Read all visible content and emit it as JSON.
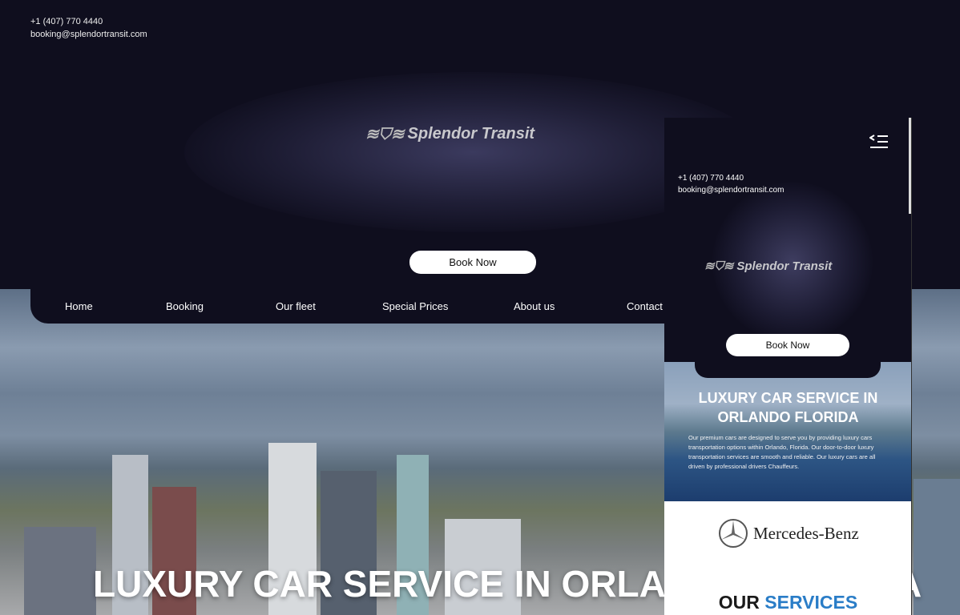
{
  "header": {
    "phone": "+1 (407) 770 4440",
    "email": "booking@splendortransit.com",
    "brand": "Splendor Transit",
    "book_label": "Book Now"
  },
  "nav": {
    "items": [
      {
        "label": "Home"
      },
      {
        "label": "Booking"
      },
      {
        "label": "Our fleet"
      },
      {
        "label": "Special Prices"
      },
      {
        "label": "About us"
      },
      {
        "label": "Contact"
      }
    ]
  },
  "hero": {
    "title": "LUXURY CAR SERVICE IN ORLANDO FLORIDA"
  },
  "mobile": {
    "phone": "+1 (407) 770 4440",
    "email": "booking@splendortransit.com",
    "brand": "Splendor Transit",
    "book_label": "Book Now",
    "hero_title": "LUXURY CAR SERVICE IN ORLANDO FLORIDA",
    "hero_text": "Our premium cars are designed to serve you by providing luxury cars transportation options within Orlando, Florida. Our door-to-door luxury transportation services are smooth and reliable. Our luxury cars are all driven by professional drivers Chauffeurs.",
    "partner": "Mercedes-Benz",
    "services_a": "OUR",
    "services_b": "SERVICES"
  },
  "colors": {
    "background": "#0f0e1e",
    "accent": "#2a7dc7"
  },
  "icons": {
    "menu": "menu-collapse-icon",
    "logo": "winged-shield-icon"
  }
}
